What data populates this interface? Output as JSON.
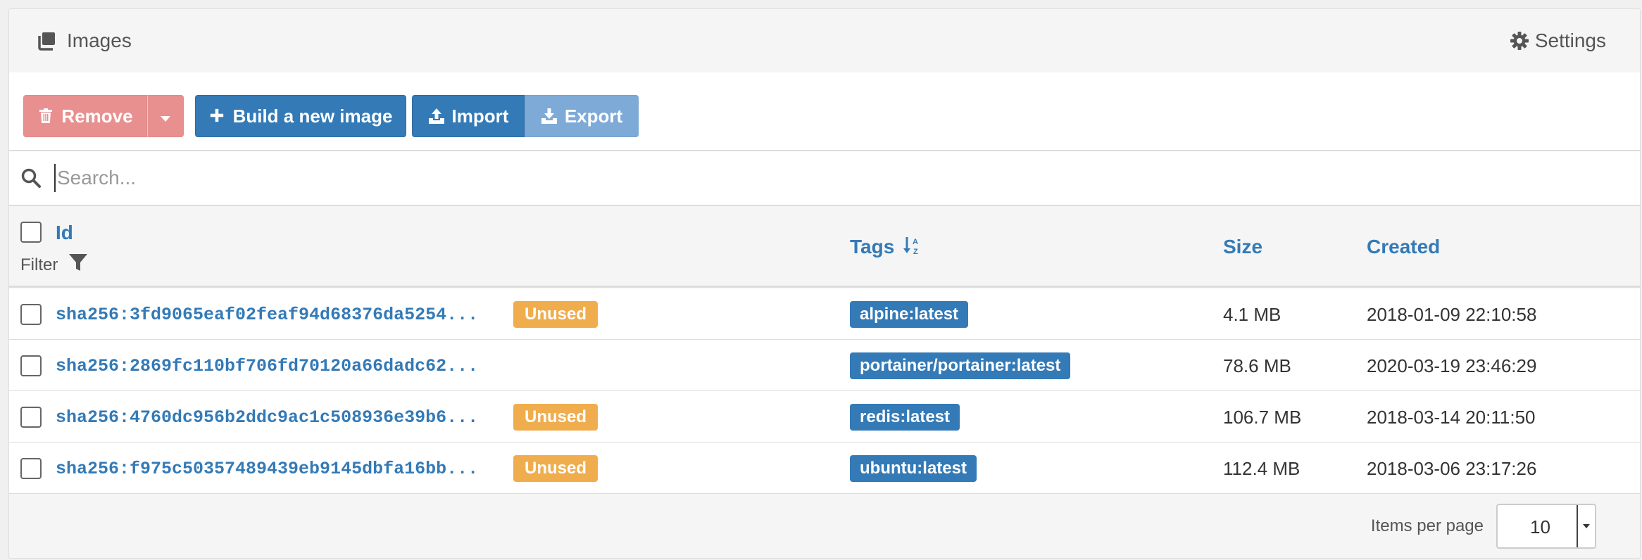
{
  "header": {
    "title": "Images",
    "title_icon": "clone-icon",
    "settings_label": "Settings",
    "settings_icon": "gear-icon"
  },
  "toolbar": {
    "remove_label": "Remove",
    "build_label": "Build a new image",
    "import_label": "Import",
    "export_label": "Export"
  },
  "search": {
    "placeholder": "Search...",
    "value": ""
  },
  "table": {
    "columns": {
      "id": "Id",
      "filter": "Filter",
      "tags": "Tags",
      "size": "Size",
      "created": "Created"
    },
    "rows": [
      {
        "id": "sha256:3fd9065eaf02feaf94d68376da5254...",
        "unused": "Unused",
        "tag": "alpine:latest",
        "size": "4.1 MB",
        "created": "2018-01-09 22:10:58"
      },
      {
        "id": "sha256:2869fc110bf706fd70120a66dadc62...",
        "unused": "",
        "tag": "portainer/portainer:latest",
        "size": "78.6 MB",
        "created": "2020-03-19 23:46:29"
      },
      {
        "id": "sha256:4760dc956b2ddc9ac1c508936e39b6...",
        "unused": "Unused",
        "tag": "redis:latest",
        "size": "106.7 MB",
        "created": "2018-03-14 20:11:50"
      },
      {
        "id": "sha256:f975c50357489439eb9145dbfa16bb...",
        "unused": "Unused",
        "tag": "ubuntu:latest",
        "size": "112.4 MB",
        "created": "2018-03-06 23:17:26"
      }
    ]
  },
  "pagination": {
    "items_per_page_label": "Items per page",
    "items_per_page_value": "10"
  },
  "colors": {
    "primary": "#337ab7",
    "danger_disabled": "#e8908f",
    "warning": "#f0ad4e",
    "primary_disabled": "#7eaad8"
  }
}
